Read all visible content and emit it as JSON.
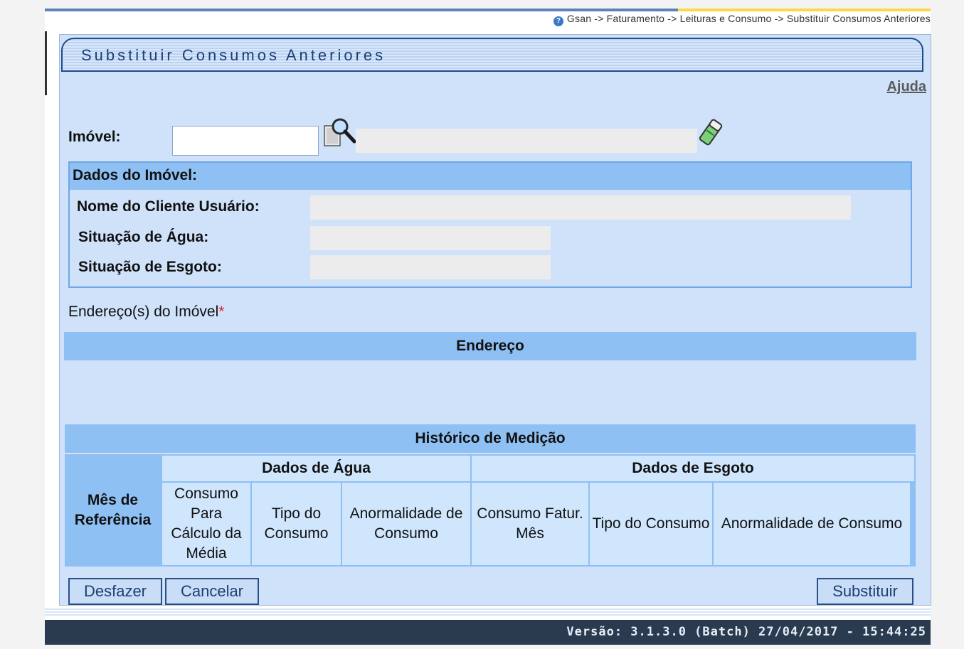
{
  "breadcrumb": "Gsan -> Faturamento -> Leituras e Consumo -> Substituir Consumos Anteriores",
  "page_title": "Substituir Consumos Anteriores",
  "help_link": "Ajuda",
  "imovel": {
    "label": "Imóvel:",
    "value": "",
    "description": ""
  },
  "dados_imovel": {
    "header": "Dados do Imóvel:",
    "nome_cliente_label": "Nome do Cliente Usuário:",
    "nome_cliente_value": "",
    "situacao_agua_label": "Situação de Água:",
    "situacao_agua_value": "",
    "situacao_esgoto_label": "Situação de Esgoto:",
    "situacao_esgoto_value": ""
  },
  "enderecos": {
    "label": "Endereço(s) do Imóvel",
    "required_mark": "*",
    "column": "Endereço"
  },
  "historico": {
    "title": "Histórico de Medição",
    "mes_referencia": "Mês de Referência",
    "grupo_agua": "Dados de Água",
    "grupo_esgoto": "Dados de Esgoto",
    "agua_cols": [
      "Consumo Para Cálculo da Média",
      "Tipo do Consumo",
      "Anormalidade de Consumo"
    ],
    "esgoto_cols": [
      "Consumo Fatur. Mês",
      "Tipo do Consumo",
      "Anormalidade de Consumo"
    ]
  },
  "buttons": {
    "desfazer": "Desfazer",
    "cancelar": "Cancelar",
    "substituir": "Substituir"
  },
  "footer": "Versão: 3.1.3.0 (Batch) 27/04/2017 - 15:44:25",
  "colors": {
    "panel": "#cfe2fa",
    "band": "#8fc0f3",
    "footer": "#2a3a4f",
    "title": "#1c3f75"
  }
}
